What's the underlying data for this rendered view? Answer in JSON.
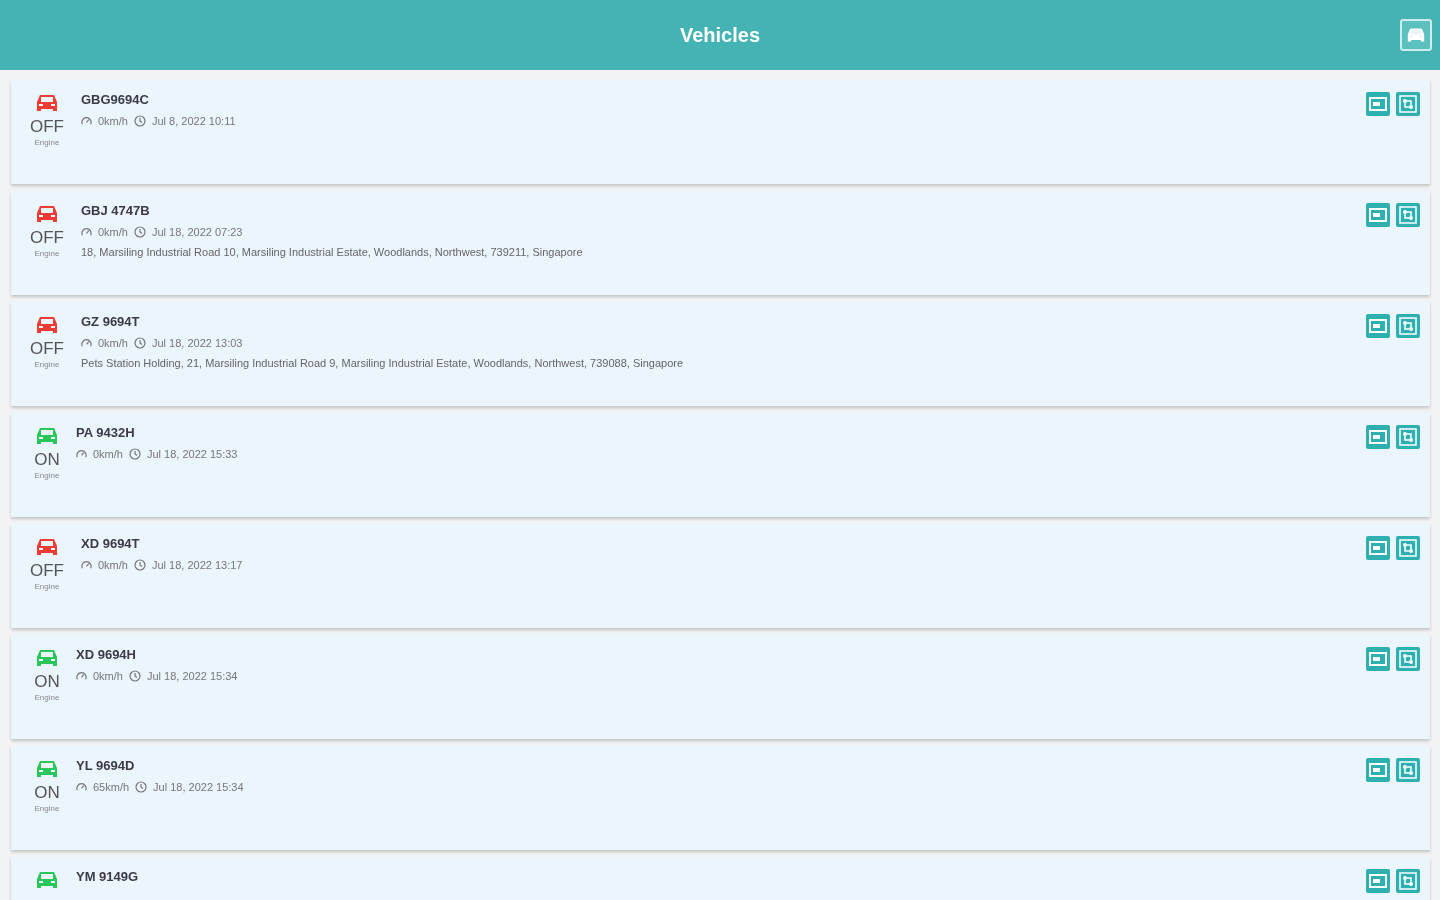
{
  "header": {
    "title": "Vehicles"
  },
  "vehicles": [
    {
      "plate": "GBG9694C",
      "engine_on": false,
      "status": "OFF",
      "engine_label": "Engine",
      "speed": "0km/h",
      "time": "Jul 8, 2022 10:11"
    },
    {
      "plate": "GBJ 4747B",
      "engine_on": false,
      "status": "OFF",
      "engine_label": "Engine",
      "speed": "0km/h",
      "time": "Jul 18, 2022 07:23",
      "address": "18, Marsiling Industrial Road 10, Marsiling Industrial Estate, Woodlands, Northwest, 739211, Singapore"
    },
    {
      "plate": "GZ 9694T",
      "engine_on": false,
      "status": "OFF",
      "engine_label": "Engine",
      "speed": "0km/h",
      "time": "Jul 18, 2022 13:03",
      "address": "Pets Station Holding, 21, Marsiling Industrial Road 9, Marsiling Industrial Estate, Woodlands, Northwest, 739088, Singapore"
    },
    {
      "plate": "PA 9432H",
      "engine_on": true,
      "status": "ON",
      "engine_label": "Engine",
      "speed": "0km/h",
      "time": "Jul 18, 2022 15:33"
    },
    {
      "plate": "XD 9694T",
      "engine_on": false,
      "status": "OFF",
      "engine_label": "Engine",
      "speed": "0km/h",
      "time": "Jul 18, 2022 13:17"
    },
    {
      "plate": "XD 9694H",
      "engine_on": true,
      "status": "ON",
      "engine_label": "Engine",
      "speed": "0km/h",
      "time": "Jul 18, 2022 15:34"
    },
    {
      "plate": "YL 9694D",
      "engine_on": true,
      "status": "ON",
      "engine_label": "Engine",
      "speed": "65km/h",
      "time": "Jul 18, 2022 15:34"
    },
    {
      "plate": "YM 9149G",
      "engine_on": true
    }
  ]
}
